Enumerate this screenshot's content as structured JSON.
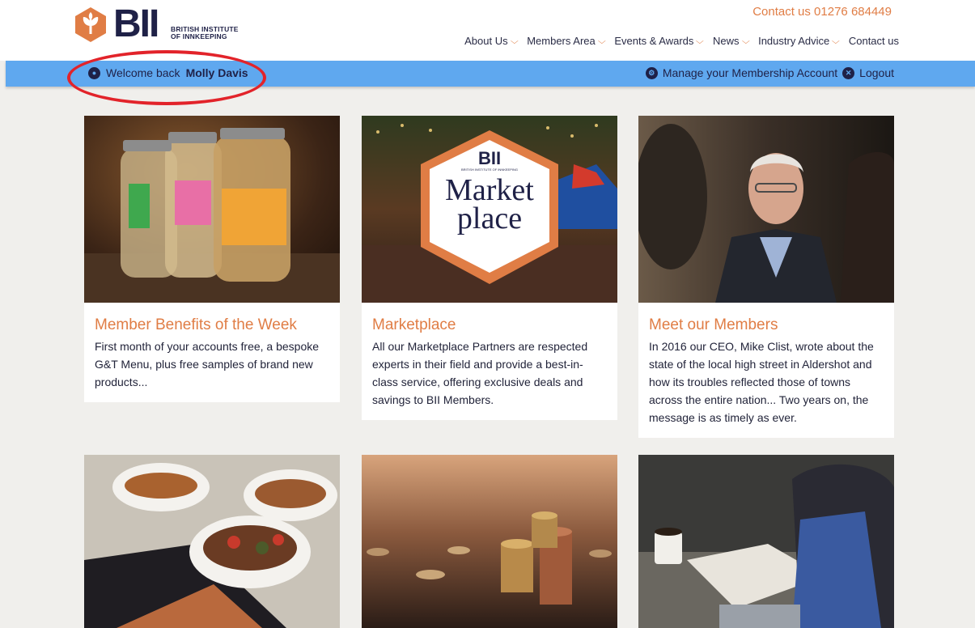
{
  "logo": {
    "text": "BII",
    "subtitle_line1": "BRITISH INSTITUTE",
    "subtitle_line2": "OF INNKEEPING"
  },
  "header": {
    "contact": "Contact us 01276 684449"
  },
  "nav": [
    {
      "label": "About Us",
      "dropdown": true
    },
    {
      "label": "Members Area",
      "dropdown": true
    },
    {
      "label": "Events & Awards",
      "dropdown": true
    },
    {
      "label": "News",
      "dropdown": true
    },
    {
      "label": "Industry Advice",
      "dropdown": true
    },
    {
      "label": "Contact us",
      "dropdown": false
    }
  ],
  "member_bar": {
    "welcome_prefix": "Welcome back",
    "user_name": "Molly Davis",
    "manage_label": "Manage your Membership Account",
    "logout_label": "Logout"
  },
  "cards": [
    {
      "title": "Member Benefits of the Week",
      "text": "First month of your accounts free, a bespoke G&T Menu, plus free samples of brand new products..."
    },
    {
      "title": "Marketplace",
      "text": "All our Marketplace Partners are respected experts in their field and provide a best-in-class service, offering exclusive deals and savings to BII Members.",
      "image_logo": "BII",
      "image_logo_sub": "BRITISH INSTITUTE OF INNKEEPING",
      "image_word1": "Market",
      "image_word2": "place"
    },
    {
      "title": "Meet our Members",
      "text": "In 2016 our CEO, Mike Clist, wrote about the state of the local high street in Aldershot and how its troubles reflected those of towns across the entire nation... Two years on, the message is as timely as ever."
    }
  ],
  "colors": {
    "accent": "#e07d45",
    "navy": "#1f2147",
    "bar": "#5fa8ef",
    "highlight": "#e2232a"
  }
}
